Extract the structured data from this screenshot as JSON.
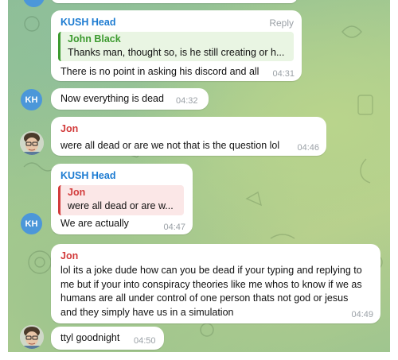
{
  "colors": {
    "kush_name": "#1c7bd1",
    "john_name": "#3c9a2f",
    "jon_name": "#d23b3b",
    "kh_avatar": "#4c97d9",
    "time": "#9aa0a6"
  },
  "messages": [
    {
      "sender": "KUSH Head",
      "reply_label": "Reply",
      "quote": {
        "name": "John Black",
        "text": "Thanks man, thought so, is he still creating or h..."
      },
      "text": "There is no point in asking his discord and all",
      "time": "04:31"
    },
    {
      "text": "Now everything is dead",
      "time": "04:32",
      "avatar": "KH"
    },
    {
      "sender": "Jon",
      "text": "were all dead or are we not that is the question lol",
      "time": "04:46"
    },
    {
      "sender": "KUSH Head",
      "quote": {
        "name": "Jon",
        "text": "were all dead or are w..."
      },
      "text": "We are actually",
      "time": "04:47",
      "avatar": "KH"
    },
    {
      "sender": "Jon",
      "lines": [
        "lol its a joke dude how can you be dead if your typing and replying to",
        "me but if your into conspiracy theories like me whos to know if we as",
        "humans are all under control of one person thats not god or jesus",
        "and they simply have us in a simulation"
      ],
      "time": "04:49"
    },
    {
      "text": "ttyl goodnight",
      "time": "04:50"
    }
  ]
}
